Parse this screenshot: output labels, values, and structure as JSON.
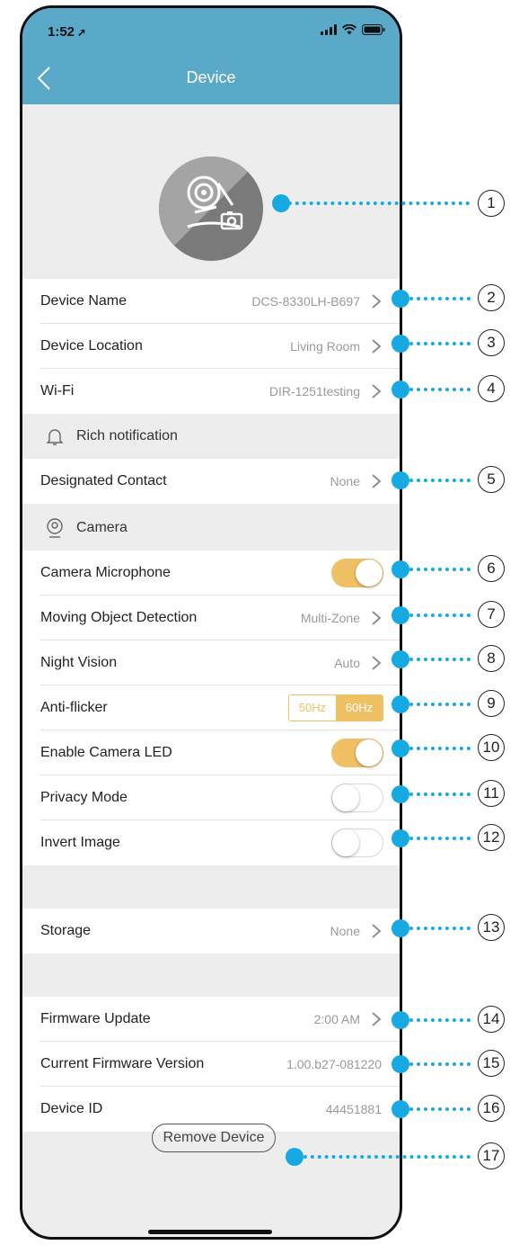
{
  "status_bar": {
    "time": "1:52"
  },
  "nav": {
    "title": "Device"
  },
  "device_rows": [
    {
      "label": "Device Name",
      "value": "DCS-8330LH-B697"
    },
    {
      "label": "Device Location",
      "value": "Living Room"
    },
    {
      "label": "Wi-Fi",
      "value": "DIR-1251testing"
    }
  ],
  "rich_notification": {
    "header": "Rich notification",
    "designated_contact": {
      "label": "Designated Contact",
      "value": "None"
    }
  },
  "camera": {
    "header": "Camera",
    "microphone": {
      "label": "Camera Microphone",
      "on": true
    },
    "motion": {
      "label": "Moving Object Detection",
      "value": "Multi-Zone"
    },
    "night_vision": {
      "label": "Night Vision",
      "value": "Auto"
    },
    "anti_flicker": {
      "label": "Anti-flicker",
      "options": [
        "50Hz",
        "60Hz"
      ],
      "selected": "60Hz"
    },
    "led": {
      "label": "Enable Camera LED",
      "on": true
    },
    "privacy": {
      "label": "Privacy Mode",
      "on": false
    },
    "invert": {
      "label": "Invert Image",
      "on": false
    }
  },
  "storage": {
    "label": "Storage",
    "value": "None"
  },
  "firmware": {
    "update": {
      "label": "Firmware Update",
      "value": "2:00 AM"
    },
    "version": {
      "label": "Current Firmware Version",
      "value": "1.00.b27-081220"
    },
    "device_id": {
      "label": "Device ID",
      "value": "44451881"
    }
  },
  "remove_button": "Remove Device",
  "callouts": [
    "1",
    "2",
    "3",
    "4",
    "5",
    "6",
    "7",
    "8",
    "9",
    "10",
    "11",
    "12",
    "13",
    "14",
    "15",
    "16",
    "17"
  ],
  "colors": {
    "accent": "#5ba9c8",
    "toggle_on": "#f0c064",
    "callout": "#17a9e1",
    "background": "#ededee"
  }
}
